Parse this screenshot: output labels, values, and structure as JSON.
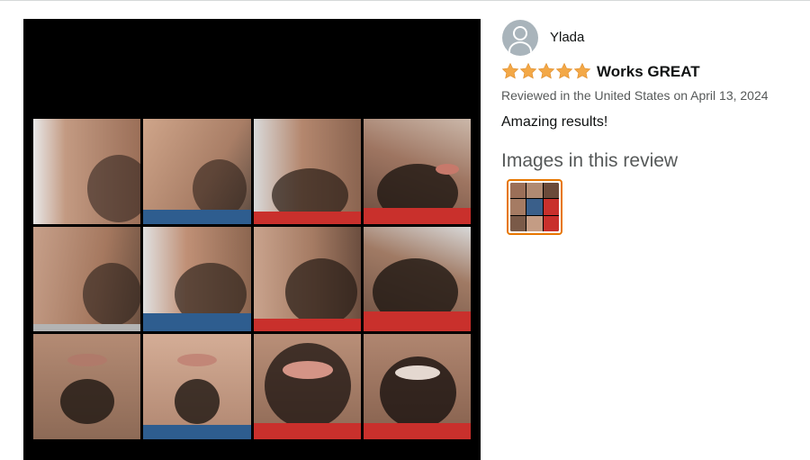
{
  "review": {
    "reviewer_name": "Ylada",
    "rating_value": 5,
    "rating_max": 5,
    "title": "Works GREAT",
    "meta": "Reviewed in the United States on April 13, 2024",
    "body": "Amazing results!",
    "images_heading": "Images in this review"
  },
  "colors": {
    "star": "#f3a847",
    "thumb_border": "#e77600",
    "meta_text": "#565959"
  },
  "icons": {
    "avatar": "user-avatar-icon",
    "star": "star-icon"
  }
}
